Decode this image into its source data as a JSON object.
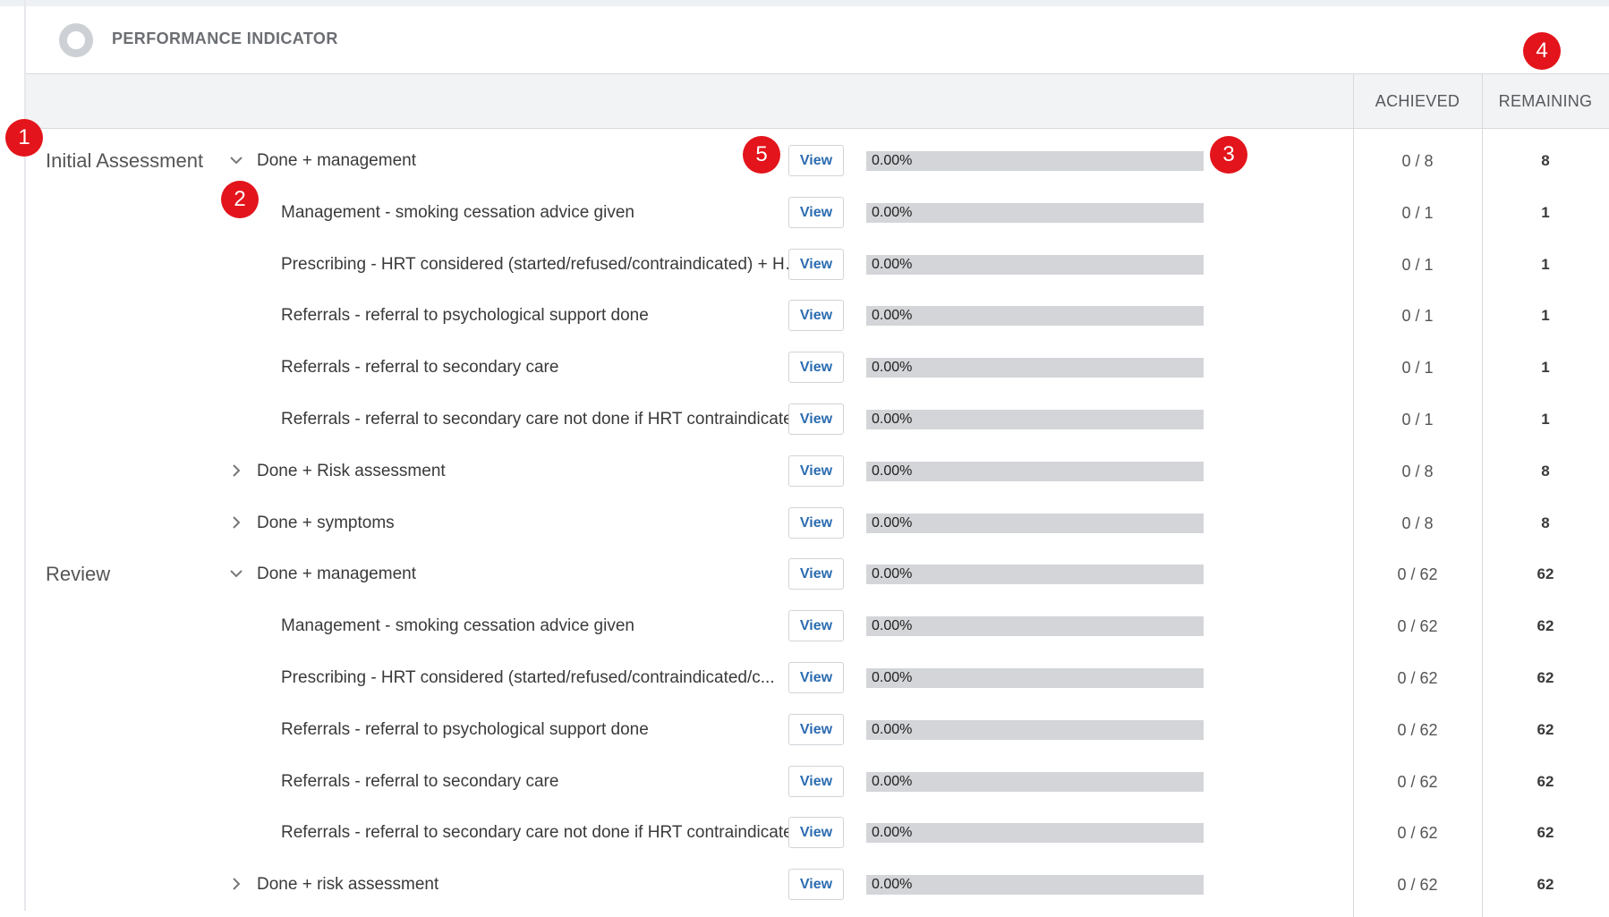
{
  "panel": {
    "title": "PERFORMANCE INDICATOR",
    "icon": "ring-icon"
  },
  "columns": {
    "achieved": "ACHIEVED",
    "remaining": "REMAINING"
  },
  "sections": [
    {
      "label": "Initial Assessment",
      "rows": [
        {
          "level": 1,
          "expanded": true,
          "label": "Done + management",
          "view": "View",
          "progress": "0.00%",
          "achieved": "0 / 8",
          "remaining": "8"
        },
        {
          "level": 2,
          "label": "Management - smoking cessation advice given",
          "view": "View",
          "progress": "0.00%",
          "achieved": "0 / 1",
          "remaining": "1"
        },
        {
          "level": 2,
          "label": "Prescribing - HRT considered (started/refused/contraindicated) + HRT review",
          "view": "View",
          "progress": "0.00%",
          "achieved": "0 / 1",
          "remaining": "1"
        },
        {
          "level": 2,
          "label": "Referrals - referral to psychological support done",
          "view": "View",
          "progress": "0.00%",
          "achieved": "0 / 1",
          "remaining": "1"
        },
        {
          "level": 2,
          "label": "Referrals - referral to secondary care",
          "view": "View",
          "progress": "0.00%",
          "achieved": "0 / 1",
          "remaining": "1"
        },
        {
          "level": 2,
          "label": "Referrals - referral to secondary care not done if HRT contraindicated",
          "view": "View",
          "progress": "0.00%",
          "achieved": "0 / 1",
          "remaining": "1"
        },
        {
          "level": 1,
          "expanded": false,
          "label": "Done + Risk assessment",
          "view": "View",
          "progress": "0.00%",
          "achieved": "0 / 8",
          "remaining": "8"
        },
        {
          "level": 1,
          "expanded": false,
          "label": "Done + symptoms",
          "view": "View",
          "progress": "0.00%",
          "achieved": "0 / 8",
          "remaining": "8"
        }
      ]
    },
    {
      "label": "Review",
      "rows": [
        {
          "level": 1,
          "expanded": true,
          "label": "Done + management",
          "view": "View",
          "progress": "0.00%",
          "achieved": "0 / 62",
          "remaining": "62"
        },
        {
          "level": 2,
          "label": "Management - smoking cessation advice given",
          "view": "View",
          "progress": "0.00%",
          "achieved": "0 / 62",
          "remaining": "62"
        },
        {
          "level": 2,
          "label": "Prescribing - HRT considered (started/refused/contraindicated/c...",
          "view": "View",
          "progress": "0.00%",
          "achieved": "0 / 62",
          "remaining": "62"
        },
        {
          "level": 2,
          "label": "Referrals - referral to psychological support done",
          "view": "View",
          "progress": "0.00%",
          "achieved": "0 / 62",
          "remaining": "62"
        },
        {
          "level": 2,
          "label": "Referrals - referral to secondary care",
          "view": "View",
          "progress": "0.00%",
          "achieved": "0 / 62",
          "remaining": "62"
        },
        {
          "level": 2,
          "label": "Referrals - referral to secondary care not done if HRT contraindicated",
          "view": "View",
          "progress": "0.00%",
          "achieved": "0 / 62",
          "remaining": "62"
        },
        {
          "level": 1,
          "expanded": false,
          "label": "Done + risk assessment",
          "view": "View",
          "progress": "0.00%",
          "achieved": "0 / 62",
          "remaining": "62"
        }
      ]
    }
  ],
  "annotations": [
    "1",
    "2",
    "3",
    "4",
    "5"
  ],
  "colors": {
    "badge": "#e3141b",
    "link": "#2b6cb0",
    "progress_track": "#d3d5d8",
    "header_bg": "#f2f3f5"
  }
}
